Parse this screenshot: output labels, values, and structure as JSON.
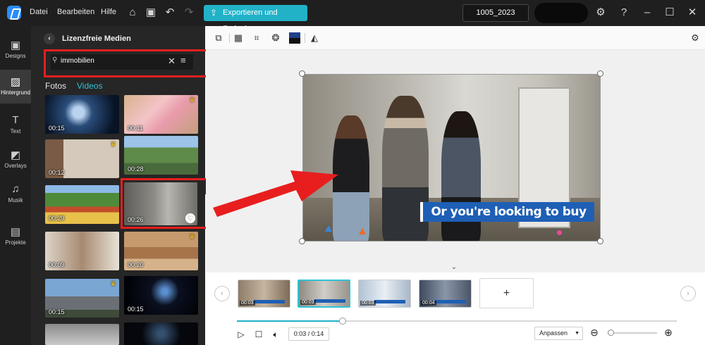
{
  "titlebar": {
    "menu": [
      "Datei",
      "Bearbeiten",
      "Hilfe"
    ],
    "export_label": "Exportieren und Freigeben",
    "project_name": "1005_2023",
    "icons": [
      "home-icon",
      "save-icon",
      "undo-icon",
      "redo-icon",
      "settings-icon",
      "help-icon",
      "minimize-icon",
      "maximize-icon",
      "close-icon"
    ]
  },
  "rail": {
    "items": [
      {
        "label": "Designs",
        "icon": "designs-icon",
        "glyph": "▣"
      },
      {
        "label": "Hintergrund",
        "icon": "background-icon",
        "glyph": "▨",
        "active": true
      },
      {
        "label": "Text",
        "icon": "text-icon",
        "glyph": "T"
      },
      {
        "label": "Overlays",
        "icon": "overlays-icon",
        "glyph": "◩"
      },
      {
        "label": "Musik",
        "icon": "music-icon",
        "glyph": "♫"
      },
      {
        "label": "Projekte",
        "icon": "projects-icon",
        "glyph": "▤"
      }
    ]
  },
  "panel": {
    "title": "Lizenzfreie Medien",
    "search_value": "immobilien",
    "tabs": {
      "fotos": "Fotos",
      "videos": "Videos"
    },
    "active_tab": "Videos",
    "thumbnails": [
      {
        "duration": "00:15",
        "premium": false
      },
      {
        "duration": "00:11",
        "premium": true
      },
      {
        "duration": "00:12",
        "premium": true
      },
      {
        "duration": "00:28",
        "premium": false
      },
      {
        "duration": "00:29",
        "premium": false
      },
      {
        "duration": "00:26",
        "premium": false,
        "favorite": true,
        "selected": true
      },
      {
        "duration": "00:09",
        "premium": false
      },
      {
        "duration": "00:20",
        "premium": true
      },
      {
        "duration": "00:15",
        "premium": true
      },
      {
        "duration": "00:15",
        "premium": false
      },
      {
        "duration": "",
        "premium": false
      },
      {
        "duration": "",
        "premium": false
      }
    ]
  },
  "canvas": {
    "caption": "Or you're looking to buy"
  },
  "timeline": {
    "clips": [
      {
        "duration": "00:03"
      },
      {
        "duration": "00:03",
        "active": true
      },
      {
        "duration": "00:03"
      },
      {
        "duration": "00:04"
      }
    ],
    "add_label": "+",
    "progress_fraction": 0.24,
    "time_display": "0:03 / 0:14",
    "fit_label": "Anpassen",
    "zoom_fraction": 0.05
  },
  "colors": {
    "accent": "#21b2c8",
    "highlight_red": "#e81e1e",
    "caption_bg": "#1e5fb5"
  }
}
